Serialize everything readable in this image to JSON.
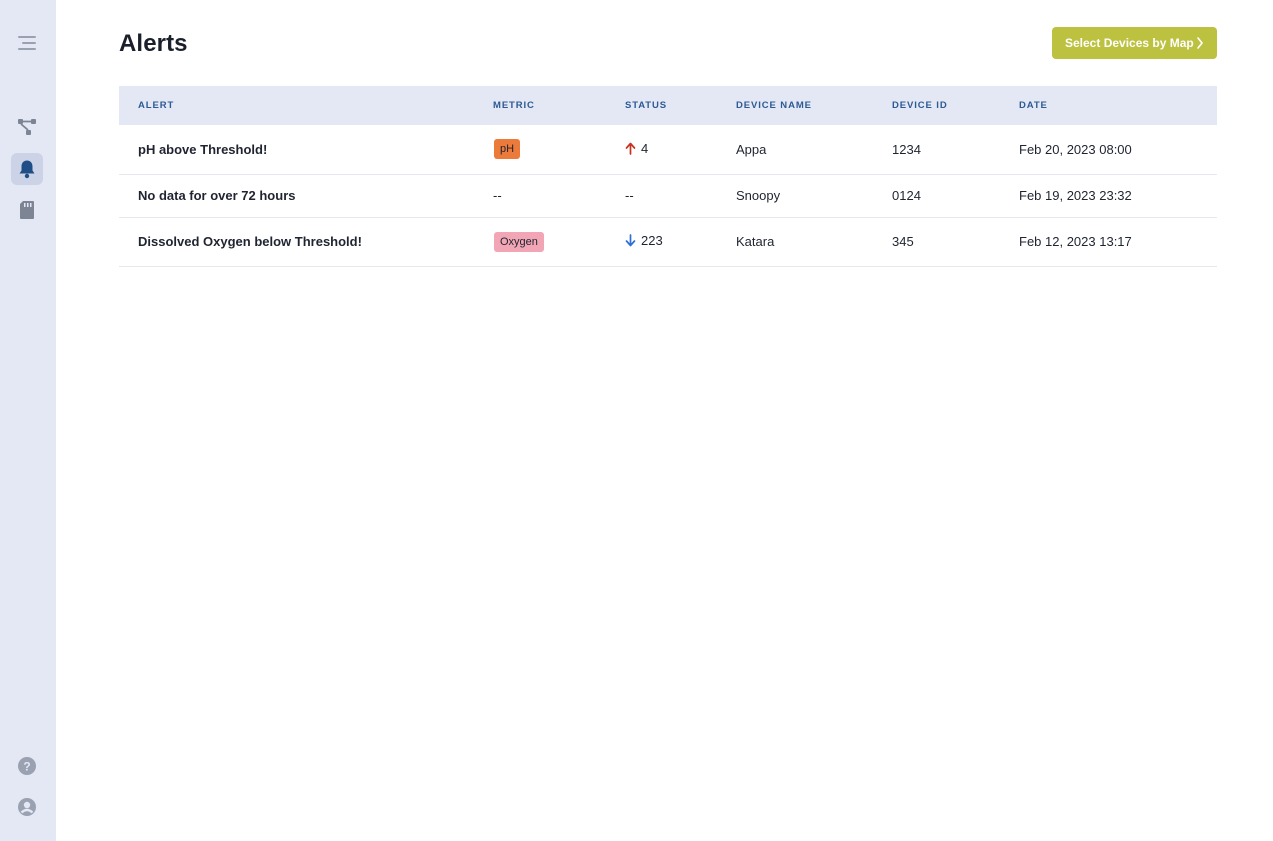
{
  "sidebar": {
    "items": [
      {
        "icon": "menu-icon",
        "active": false
      },
      {
        "icon": "network-icon",
        "active": false
      },
      {
        "icon": "bell-icon",
        "active": true
      },
      {
        "icon": "sd-card-icon",
        "active": false
      },
      {
        "icon": "help-icon",
        "active": false
      },
      {
        "icon": "user-icon",
        "active": false
      }
    ]
  },
  "header": {
    "title": "Alerts",
    "map_button_label": "Select Devices by Map"
  },
  "table": {
    "columns": [
      "ALERT",
      "METRIC",
      "STATUS",
      "DEVICE NAME",
      "DEVICE ID",
      "DATE"
    ],
    "rows": [
      {
        "alert": "pH above Threshold!",
        "metric": "pH",
        "status_dir": "up",
        "status": "4",
        "device_name": "Appa",
        "device_id": "1234",
        "date": "Feb 20, 2023 08:00"
      },
      {
        "alert": "No data for over 72 hours",
        "metric": "--",
        "status_dir": "none",
        "status": "--",
        "device_name": "Snoopy",
        "device_id": "0124",
        "date": "Feb 19, 2023 23:32"
      },
      {
        "alert": "Dissolved Oxygen below Threshold!",
        "metric": "Oxygen",
        "status_dir": "down",
        "status": "223",
        "device_name": "Katara",
        "device_id": "345",
        "date": "Feb 12, 2023 13:17"
      }
    ]
  },
  "colors": {
    "sidebar_bg": "#e4e8f5",
    "accent_button": "#bcc140",
    "header_text": "#2c5a93",
    "ph_badge": "#ec7a3a",
    "oxygen_badge": "#f2a6b5",
    "up_arrow": "#c8321e",
    "down_arrow": "#2f6fd6"
  }
}
